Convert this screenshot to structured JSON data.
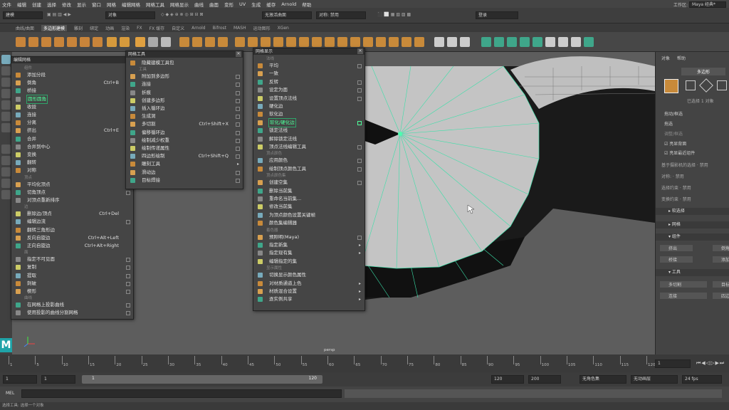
{
  "menubar": {
    "items": [
      "文件",
      "编辑",
      "创建",
      "选择",
      "修改",
      "显示",
      "窗口",
      "网格",
      "编辑网格",
      "网格工具",
      "网格显示",
      "曲线",
      "曲面",
      "变形",
      "UV",
      "生成",
      "缓存",
      "Arnold",
      "帮助"
    ],
    "workspace_label": "工作区:",
    "workspace_value": "Maya 经典*"
  },
  "statusline": {
    "mode": "建模",
    "object_label": "对象",
    "live_surface": "无激活曲面",
    "symmetry": "对称: 禁用",
    "login": "登录"
  },
  "shelf": {
    "tabs": [
      "曲线/曲面",
      "多边形建模",
      "雕刻",
      "绑定",
      "动画",
      "渲染",
      "FX",
      "FX 缓存",
      "自定义",
      "Arnold",
      "Bifrost",
      "MASH",
      "运动图形",
      "XGen"
    ],
    "active_tab": "多边形建模"
  },
  "viewport": {
    "camera_label": "persp"
  },
  "edit_mesh_menu": {
    "title": "编辑网格",
    "items": [
      {
        "label": "添加分段",
        "shortcut": "",
        "box": true
      },
      {
        "label": "倒角",
        "shortcut": "Ctrl+B",
        "box": true
      },
      {
        "label": "桥接",
        "shortcut": "",
        "box": true
      },
      {
        "label": "圆形圆角",
        "shortcut": "",
        "box": true,
        "highlight": true
      },
      {
        "label": "收拢",
        "shortcut": "",
        "box": false
      },
      {
        "label": "连接",
        "shortcut": "",
        "box": true
      },
      {
        "label": "分离",
        "shortcut": "",
        "box": false
      },
      {
        "label": "挤出",
        "shortcut": "Ctrl+E",
        "box": true
      },
      {
        "label": "合并",
        "shortcut": "",
        "box": true
      },
      {
        "label": "合并到中心",
        "shortcut": "",
        "box": false
      },
      {
        "label": "变换",
        "shortcut": "",
        "box": true
      },
      {
        "label": "翻转",
        "shortcut": "",
        "box": true
      },
      {
        "label": "对称",
        "shortcut": "",
        "box": true
      },
      {
        "label": "平均化顶点",
        "shortcut": "",
        "box": true
      },
      {
        "label": "切角顶点",
        "shortcut": "",
        "box": true
      },
      {
        "label": "对顶点重新排序",
        "shortcut": "",
        "box": false
      },
      {
        "label": "删除边/顶点",
        "shortcut": "Ctrl+Del",
        "box": false
      },
      {
        "label": "编辑边流",
        "shortcut": "",
        "box": true
      },
      {
        "label": "翻转三角形边",
        "shortcut": "",
        "box": false
      },
      {
        "label": "反向自旋边",
        "shortcut": "Ctrl+Alt+Left",
        "box": false
      },
      {
        "label": "正向自旋边",
        "shortcut": "Ctrl+Alt+Right",
        "box": false
      },
      {
        "label": "指定不可见面",
        "shortcut": "",
        "box": true
      },
      {
        "label": "复制",
        "shortcut": "",
        "box": true
      },
      {
        "label": "提取",
        "shortcut": "",
        "box": true
      },
      {
        "label": "刺破",
        "shortcut": "",
        "box": true
      },
      {
        "label": "楔形",
        "shortcut": "",
        "box": true
      },
      {
        "label": "在网格上投影曲线",
        "shortcut": "",
        "box": true
      },
      {
        "label": "使用投影的曲线分割网格",
        "shortcut": "",
        "box": true
      }
    ],
    "sections": [
      "组件",
      "顶点",
      "边",
      "面",
      "曲线"
    ]
  },
  "mesh_tools_menu": {
    "title": "网格工具",
    "items": [
      {
        "label": "隐藏建模工具包",
        "shortcut": "",
        "box": false
      },
      {
        "label": "附加到多边形",
        "shortcut": "",
        "box": true
      },
      {
        "label": "连接",
        "shortcut": "",
        "box": true
      },
      {
        "label": "折痕",
        "shortcut": "",
        "box": true
      },
      {
        "label": "创建多边形",
        "shortcut": "",
        "box": true
      },
      {
        "label": "插入循环边",
        "shortcut": "",
        "box": true
      },
      {
        "label": "生成洞",
        "shortcut": "",
        "box": true
      },
      {
        "label": "多切割",
        "shortcut": "Ctrl+Shift+X",
        "box": true
      },
      {
        "label": "偏移循环边",
        "shortcut": "",
        "box": true
      },
      {
        "label": "绘制减少权重",
        "shortcut": "",
        "box": true
      },
      {
        "label": "绘制传递属性",
        "shortcut": "",
        "box": true
      },
      {
        "label": "四边形绘制",
        "shortcut": "Ctrl+Shift+Q",
        "box": true
      },
      {
        "label": "雕刻工具",
        "shortcut": "",
        "arrow": true
      },
      {
        "label": "滑动边",
        "shortcut": "",
        "box": true
      },
      {
        "label": "目标焊接",
        "shortcut": "",
        "box": true
      }
    ],
    "section": "工具"
  },
  "mesh_display_menu": {
    "title": "网格显示",
    "items": [
      {
        "label": "平均",
        "box": true
      },
      {
        "label": "一致",
        "box": false
      },
      {
        "label": "反转",
        "box": true
      },
      {
        "label": "设定为面",
        "box": true
      },
      {
        "label": "设置顶点法线",
        "box": true
      },
      {
        "label": "硬化边",
        "box": false
      },
      {
        "label": "软化边",
        "box": false
      },
      {
        "label": "软化/硬化边",
        "box": true,
        "highlight": true
      },
      {
        "label": "锁定法线",
        "box": false
      },
      {
        "label": "解除锁定法线",
        "box": false
      },
      {
        "label": "顶点法线编辑工具",
        "box": true
      },
      {
        "label": "应用颜色",
        "box": true
      },
      {
        "label": "绘制顶点颜色工具",
        "box": true
      },
      {
        "label": "创建空集",
        "box": true
      },
      {
        "label": "删除当前集",
        "box": false
      },
      {
        "label": "重命名当前集...",
        "box": false
      },
      {
        "label": "修改当前集",
        "box": false
      },
      {
        "label": "为顶点颜色设置关键帧",
        "box": false
      },
      {
        "label": "颜色集编辑器",
        "box": false
      },
      {
        "label": "预照明(Maya)",
        "box": true
      },
      {
        "label": "指定新集",
        "box": false,
        "arrow": true
      },
      {
        "label": "指定现有集",
        "box": false,
        "arrow": true
      },
      {
        "label": "编辑指定的集",
        "box": false
      },
      {
        "label": "切换显示颜色属性",
        "box": false
      },
      {
        "label": "对材质通道上色",
        "box": false,
        "arrow": true
      },
      {
        "label": "材质混合设置",
        "box": false,
        "arrow": true
      },
      {
        "label": "逐实例共享",
        "box": false,
        "arrow": true
      }
    ],
    "sections": [
      "法线",
      "顶点颜色",
      "顶点颜色集",
      "着色器",
      "显示属性"
    ]
  },
  "right_panel": {
    "tabs": [
      "对象",
      "帮助"
    ],
    "mode_button": "多边形",
    "selected_count": "已选择 1 对象",
    "options": [
      "拖动/框选",
      "拖选",
      "调整/框选"
    ],
    "checks": [
      "亮显背面",
      "亮显最近组件"
    ],
    "camera_sel": "基于摄影机的选择 · 禁用",
    "symmetry": "对称: · 禁用",
    "soft_sel": "选择约束 · 禁用",
    "transform_constraint": "变换约束 · 禁用",
    "soft_select": "软选择",
    "sections": [
      "网格",
      "组件",
      "工具"
    ],
    "component_buttons": [
      "挤出",
      "倒角",
      "桥接",
      "添加"
    ],
    "tool_buttons": [
      "多切割",
      "目标",
      "连接",
      "四边"
    ]
  },
  "timeline": {
    "ticks": [
      "1",
      "5",
      "10",
      "15",
      "20",
      "25",
      "30",
      "35",
      "40",
      "45",
      "50",
      "55",
      "60",
      "65",
      "70",
      "75",
      "80",
      "85",
      "90",
      "95",
      "100",
      "105",
      "110",
      "115",
      "120"
    ],
    "current_frame": "1"
  },
  "range": {
    "start": "1",
    "start2": "1",
    "slider_start": "1",
    "slider_end": "120",
    "end": "120",
    "end2": "200",
    "char_set": "无角色集",
    "anim_layer": "无动画层",
    "fps": "24 fps"
  },
  "mel": {
    "label": "MEL"
  },
  "help_line": "选择工具: 选择一个对象",
  "colors": {
    "accent_green": "#39e0a8",
    "highlight": "#2ea66a"
  }
}
